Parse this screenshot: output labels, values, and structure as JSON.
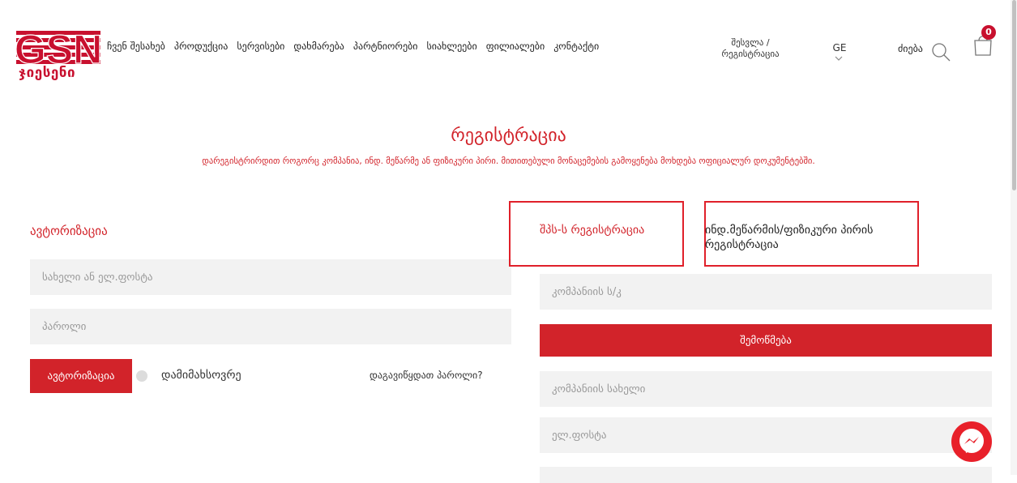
{
  "brand": {
    "logo_text": "GSN",
    "logo_subtitle": "ჯიესენი",
    "accent_color": "#d2232a"
  },
  "nav": {
    "items": [
      "ჩვენ შესახებ",
      "პროდუქცია",
      "სერვისები",
      "დახმარება",
      "პარტნიორები",
      "სიახლეები",
      "ფილიალები",
      "კონტაქტი"
    ]
  },
  "header": {
    "login_register": "შესვლა / რეგისტრაცია",
    "language": "GE",
    "search_label": "ძიება",
    "cart_count": "0"
  },
  "registration": {
    "title": "რეგისტრაცია",
    "subtitle": "დარეგისტრირდით როგორც კომპანია, ინდ. მეწარმე ან ფიზიკური პირი. მითითებული მონაცემების გამოყენება მოხდება ოფიციალურ დოკუმენტებში."
  },
  "auth": {
    "title": "ავტორიზაცია",
    "username_placeholder": "სახელი ან ელ.ფოსტა",
    "password_placeholder": "პაროლი",
    "submit_label": "ავტორიზაცია",
    "remember_label": "დამიმახსოვრე",
    "forgot_label": "დაგავიწყდათ პაროლი?"
  },
  "tabs": {
    "company": "შპს-ს რეგისტრაცია",
    "individual": "ინდ.მეწარმის/ფიზიკური პირის რეგისტრაცია"
  },
  "company_form": {
    "id_placeholder": "კომპანიის ს/კ",
    "check_label": "შემოწმება",
    "name_placeholder": "კომპანიის სახელი",
    "email_placeholder": "ელ.ფოსტა"
  }
}
